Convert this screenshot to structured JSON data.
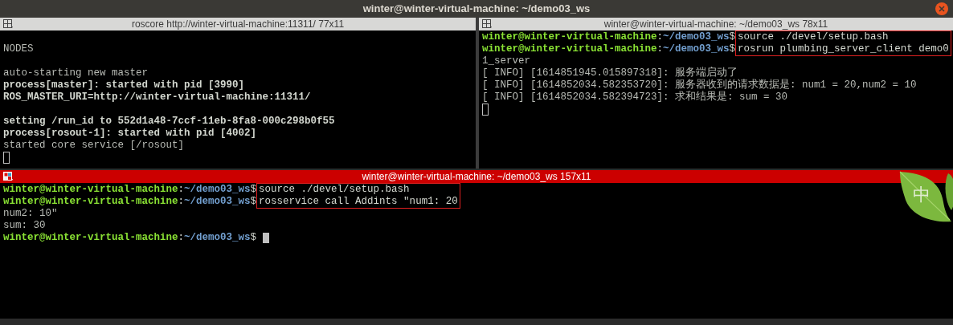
{
  "window": {
    "title": "winter@winter-virtual-machine: ~/demo03_ws"
  },
  "panes": [
    {
      "title": "roscore http://winter-virtual-machine:11311/ 77x11",
      "active": false,
      "lines": [
        {
          "kind": "blank"
        },
        {
          "kind": "text",
          "text": "NODES",
          "bold": false
        },
        {
          "kind": "blank"
        },
        {
          "kind": "text",
          "text": "auto-starting new master",
          "bold": false
        },
        {
          "kind": "text",
          "text": "process[master]: started with pid [3990]",
          "bold": true
        },
        {
          "kind": "text",
          "text": "ROS_MASTER_URI=http://winter-virtual-machine:11311/",
          "bold": true
        },
        {
          "kind": "blank"
        },
        {
          "kind": "text",
          "text": "setting /run_id to 552d1a48-7ccf-11eb-8fa8-000c298b0f55",
          "bold": true
        },
        {
          "kind": "text",
          "text": "process[rosout-1]: started with pid [4002]",
          "bold": true
        },
        {
          "kind": "text",
          "text": "started core service [/rosout]",
          "bold": false
        },
        {
          "kind": "cursor",
          "focused": false
        }
      ]
    },
    {
      "title": "winter@winter-virtual-machine: ~/demo03_ws 78x11",
      "active": false,
      "lines": [
        {
          "kind": "prompt",
          "user": "winter@winter-virtual-machine",
          "colon": ":",
          "path": "~/demo03_ws",
          "dollar": "$",
          "command": "source ./devel/setup.bash",
          "highlighted": true
        },
        {
          "kind": "prompt",
          "user": "winter@winter-virtual-machine",
          "colon": ":",
          "path": "~/demo03_ws",
          "dollar": "$",
          "command": "rosrun plumbing_server_client demo0",
          "highlighted": true
        },
        {
          "kind": "text",
          "text": "1_server",
          "bold": false
        },
        {
          "kind": "text",
          "text": "[ INFO] [1614851945.015897318]: 服务端启动了",
          "bold": false
        },
        {
          "kind": "text",
          "text": "[ INFO] [1614852034.582353720]: 服务器收到的请求数据是: num1 = 20,num2 = 10",
          "bold": false
        },
        {
          "kind": "text",
          "text": "[ INFO] [1614852034.582394723]: 求和结果是: sum = 30",
          "bold": false
        },
        {
          "kind": "cursor",
          "focused": false
        }
      ]
    },
    {
      "title": "winter@winter-virtual-machine: ~/demo03_ws 157x11",
      "active": true,
      "lines": [
        {
          "kind": "prompt",
          "user": "winter@winter-virtual-machine",
          "colon": ":",
          "path": "~/demo03_ws",
          "dollar": "$",
          "command": "source ./devel/setup.bash",
          "highlighted": true
        },
        {
          "kind": "prompt",
          "user": "winter@winter-virtual-machine",
          "colon": ":",
          "path": "~/demo03_ws",
          "dollar": "$",
          "command": "rosservice call Addints \"num1: 20",
          "highlighted": true
        },
        {
          "kind": "text",
          "text": "num2: 10\"",
          "bold": false
        },
        {
          "kind": "text",
          "text": "sum: 30",
          "bold": false
        },
        {
          "kind": "prompt",
          "user": "winter@winter-virtual-machine",
          "colon": ":",
          "path": "~/demo03_ws",
          "dollar": "$",
          "highlighted": false
        },
        {
          "kind": "cursor",
          "focused": true,
          "inline": true
        }
      ]
    }
  ],
  "ime_indicator": {
    "label": "中"
  }
}
